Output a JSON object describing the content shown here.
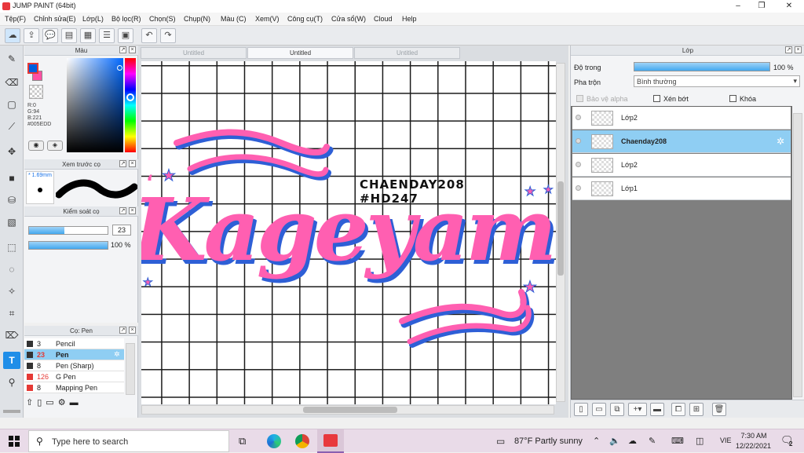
{
  "window": {
    "title": "JUMP PAINT (64bit)"
  },
  "menu": [
    "Tệp(F)",
    "Chỉnh sửa(E)",
    "Lớp(L)",
    "Bộ lọc(R)",
    "Chọn(S)",
    "Chụp(N)",
    "Màu (C)",
    "Xem(V)",
    "Công cụ(T)",
    "Cửa sổ(W)",
    "Cloud",
    "Help"
  ],
  "color_panel": {
    "title": "Màu",
    "r": "R:0",
    "g": "G:94",
    "b": "B:221",
    "hex": "#005EDD",
    "fg_color": "#005edd",
    "bg_color": "#ff4fa3"
  },
  "brush_preview": {
    "title": "Xem trước cọ",
    "size": "* 1.69mm"
  },
  "brush_control": {
    "title": "Kiểm soát cọ",
    "size": "23",
    "opacity": "100 %",
    "size_fraction": 0.45,
    "opacity_fraction": 1.0
  },
  "brush_list": {
    "title": "Cọ: Pen",
    "items": [
      {
        "size": "3",
        "name": "Pencil",
        "color": "#333333"
      },
      {
        "size": "23",
        "name": "Pen",
        "color": "#333333"
      },
      {
        "size": "8",
        "name": "Pen (Sharp)",
        "color": "#333333"
      },
      {
        "size": "126",
        "name": "G Pen",
        "color": "#e53935"
      },
      {
        "size": "8",
        "name": "Mapping Pen",
        "color": "#e53935"
      }
    ]
  },
  "doc_tabs": [
    "Untitled",
    "Untitled",
    "Untitled"
  ],
  "canvas": {
    "caption_line1": "CHAENDAY208",
    "caption_line2": "#HD247",
    "lettering": "Kageyama",
    "pink": "#ff5fb1",
    "blue": "#2e5fd6"
  },
  "layer_panel": {
    "title": "Lớp",
    "opacity_label": "Độ trong",
    "opacity_value": "100 %",
    "blend_label": "Pha trộn",
    "blend_value": "Bình thường",
    "protect_alpha": "Bảo vệ alpha",
    "clipping": "Xén bớt",
    "lock": "Khóa",
    "layers": [
      {
        "name": "Lớp2"
      },
      {
        "name": "Chaenday208"
      },
      {
        "name": "Lớp2"
      },
      {
        "name": "Lớp1"
      }
    ]
  },
  "taskbar": {
    "search_placeholder": "Type here to search",
    "weather": "87°F  Partly sunny",
    "lang": "VIE",
    "time": "7:30 AM",
    "date": "12/22/2021",
    "notifications": "2"
  }
}
